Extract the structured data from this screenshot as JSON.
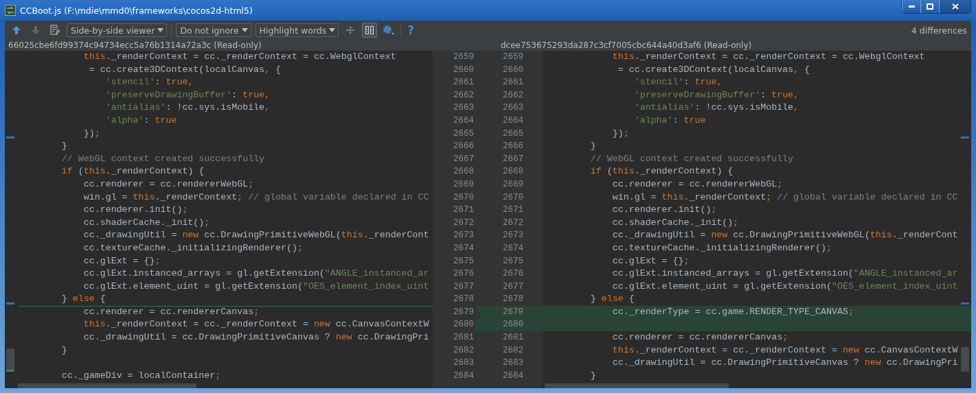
{
  "window": {
    "title": "CCBoot.js (F:\\mdie\\mmd0\\frameworks\\cocos2d-html5)"
  },
  "toolbar": {
    "buttons": [
      {
        "kind": "previous",
        "disabled": false
      },
      {
        "kind": "next",
        "disabled": true
      },
      {
        "kind": "edit",
        "disabled": false
      }
    ],
    "dropdowns": [
      "Side-by-side viewer",
      "Do not ignore",
      "Highlight words"
    ],
    "sync_scroll": {
      "selected": true
    },
    "help": "?",
    "status": "4 differences"
  },
  "panes": {
    "left": {
      "title": "66025cbe6fd99374c94734ecc5a76b1314a72a3c (Read-only)"
    },
    "right": {
      "title": "dcee753675293da287c3cf7005cbc644a40d3af6 (Read-only)"
    }
  },
  "rows": [
    {
      "left_number": "2659",
      "right_number": "2659",
      "inserted": false,
      "left": [
        {
          "kind": "keyword",
          "text": "            this"
        },
        {
          "kind": "plain",
          "text": "._renderContext = cc._renderContext = cc.WebglContext"
        }
      ],
      "right": [
        {
          "kind": "keyword",
          "text": "            this"
        },
        {
          "kind": "plain",
          "text": "._renderContext = cc._renderContext = cc.WebglContext"
        }
      ]
    },
    {
      "left_number": "2660",
      "right_number": "2660",
      "inserted": false,
      "left": [
        {
          "kind": "plain",
          "text": "             = cc.create3DContext(localCanvas"
        },
        {
          "kind": "keyword",
          "text": ","
        },
        {
          "kind": "plain",
          "text": " {"
        }
      ],
      "right": [
        {
          "kind": "plain",
          "text": "             = cc.create3DContext(localCanvas"
        },
        {
          "kind": "keyword",
          "text": ","
        },
        {
          "kind": "plain",
          "text": " {"
        }
      ]
    },
    {
      "left_number": "2661",
      "right_number": "2661",
      "inserted": false,
      "left": [
        {
          "kind": "string",
          "text": "                'stencil'"
        },
        {
          "kind": "plain",
          "text": ": "
        },
        {
          "kind": "keyword",
          "text": "true,"
        }
      ],
      "right": [
        {
          "kind": "string",
          "text": "                'stencil'"
        },
        {
          "kind": "plain",
          "text": ": "
        },
        {
          "kind": "keyword",
          "text": "true,"
        }
      ]
    },
    {
      "left_number": "2662",
      "right_number": "2662",
      "inserted": false,
      "left": [
        {
          "kind": "string",
          "text": "                'preserveDrawingBuffer'"
        },
        {
          "kind": "plain",
          "text": ": "
        },
        {
          "kind": "keyword",
          "text": "true,"
        }
      ],
      "right": [
        {
          "kind": "string",
          "text": "                'preserveDrawingBuffer'"
        },
        {
          "kind": "plain",
          "text": ": "
        },
        {
          "kind": "keyword",
          "text": "true,"
        }
      ]
    },
    {
      "left_number": "2663",
      "right_number": "2663",
      "inserted": false,
      "left": [
        {
          "kind": "string",
          "text": "                'antialias'"
        },
        {
          "kind": "plain",
          "text": ": !cc.sys.isMobile"
        },
        {
          "kind": "keyword",
          "text": ","
        }
      ],
      "right": [
        {
          "kind": "string",
          "text": "                'antialias'"
        },
        {
          "kind": "plain",
          "text": ": !cc.sys.isMobile"
        },
        {
          "kind": "keyword",
          "text": ","
        }
      ]
    },
    {
      "left_number": "2664",
      "right_number": "2664",
      "inserted": false,
      "left": [
        {
          "kind": "string",
          "text": "                'alpha'"
        },
        {
          "kind": "plain",
          "text": ": "
        },
        {
          "kind": "keyword",
          "text": "true"
        }
      ],
      "right": [
        {
          "kind": "string",
          "text": "                'alpha'"
        },
        {
          "kind": "plain",
          "text": ": "
        },
        {
          "kind": "keyword",
          "text": "true"
        }
      ]
    },
    {
      "left_number": "2665",
      "right_number": "2665",
      "inserted": false,
      "left": [
        {
          "kind": "plain",
          "text": "            })"
        },
        {
          "kind": "keyword",
          "text": ";"
        }
      ],
      "right": [
        {
          "kind": "plain",
          "text": "            })"
        },
        {
          "kind": "keyword",
          "text": ";"
        }
      ]
    },
    {
      "left_number": "2666",
      "right_number": "2666",
      "inserted": false,
      "left": [
        {
          "kind": "plain",
          "text": "        }"
        }
      ],
      "right": [
        {
          "kind": "plain",
          "text": "        }"
        }
      ]
    },
    {
      "left_number": "2667",
      "right_number": "2667",
      "inserted": false,
      "left": [
        {
          "kind": "comment",
          "text": "        // WebGL context created successfully"
        }
      ],
      "right": [
        {
          "kind": "comment",
          "text": "        // WebGL context created successfully"
        }
      ]
    },
    {
      "left_number": "2668",
      "right_number": "2668",
      "inserted": false,
      "left": [
        {
          "kind": "keyword",
          "text": "        if"
        },
        {
          "kind": "plain",
          "text": " ("
        },
        {
          "kind": "keyword",
          "text": "this"
        },
        {
          "kind": "plain",
          "text": "._renderContext) {"
        }
      ],
      "right": [
        {
          "kind": "keyword",
          "text": "        if"
        },
        {
          "kind": "plain",
          "text": " ("
        },
        {
          "kind": "keyword",
          "text": "this"
        },
        {
          "kind": "plain",
          "text": "._renderContext) {"
        }
      ]
    },
    {
      "left_number": "2669",
      "right_number": "2669",
      "inserted": false,
      "left": [
        {
          "kind": "plain",
          "text": "            cc.renderer = cc.rendererWebGL"
        },
        {
          "kind": "keyword",
          "text": ";"
        }
      ],
      "right": [
        {
          "kind": "plain",
          "text": "            cc.renderer = cc.rendererWebGL"
        },
        {
          "kind": "keyword",
          "text": ";"
        }
      ]
    },
    {
      "left_number": "2670",
      "right_number": "2670",
      "inserted": false,
      "left": [
        {
          "kind": "plain",
          "text": "            win.gl = "
        },
        {
          "kind": "keyword",
          "text": "this"
        },
        {
          "kind": "plain",
          "text": "._renderContext"
        },
        {
          "kind": "keyword",
          "text": ";"
        },
        {
          "kind": "comment",
          "text": " // global variable declared in CC"
        }
      ],
      "right": [
        {
          "kind": "plain",
          "text": "            win.gl = "
        },
        {
          "kind": "keyword",
          "text": "this"
        },
        {
          "kind": "plain",
          "text": "._renderContext"
        },
        {
          "kind": "keyword",
          "text": ";"
        },
        {
          "kind": "comment",
          "text": " // global variable declared in CC"
        }
      ]
    },
    {
      "left_number": "2671",
      "right_number": "2671",
      "inserted": false,
      "left": [
        {
          "kind": "plain",
          "text": "            cc.renderer.init()"
        },
        {
          "kind": "keyword",
          "text": ";"
        }
      ],
      "right": [
        {
          "kind": "plain",
          "text": "            cc.renderer.init()"
        },
        {
          "kind": "keyword",
          "text": ";"
        }
      ]
    },
    {
      "left_number": "2672",
      "right_number": "2672",
      "inserted": false,
      "left": [
        {
          "kind": "plain",
          "text": "            cc.shaderCache._init()"
        },
        {
          "kind": "keyword",
          "text": ";"
        }
      ],
      "right": [
        {
          "kind": "plain",
          "text": "            cc.shaderCache._init()"
        },
        {
          "kind": "keyword",
          "text": ";"
        }
      ]
    },
    {
      "left_number": "2673",
      "right_number": "2673",
      "inserted": false,
      "left": [
        {
          "kind": "plain",
          "text": "            cc._drawingUtil = "
        },
        {
          "kind": "keyword",
          "text": "new"
        },
        {
          "kind": "plain",
          "text": " cc.DrawingPrimitiveWebGL("
        },
        {
          "kind": "keyword",
          "text": "this"
        },
        {
          "kind": "plain",
          "text": "._renderCont"
        }
      ],
      "right": [
        {
          "kind": "plain",
          "text": "            cc._drawingUtil = "
        },
        {
          "kind": "keyword",
          "text": "new"
        },
        {
          "kind": "plain",
          "text": " cc.DrawingPrimitiveWebGL("
        },
        {
          "kind": "keyword",
          "text": "this"
        },
        {
          "kind": "plain",
          "text": "._renderCont"
        }
      ]
    },
    {
      "left_number": "2674",
      "right_number": "2674",
      "inserted": false,
      "left": [
        {
          "kind": "plain",
          "text": "            cc.textureCache._initializingRenderer()"
        },
        {
          "kind": "keyword",
          "text": ";"
        }
      ],
      "right": [
        {
          "kind": "plain",
          "text": "            cc.textureCache._initializingRenderer()"
        },
        {
          "kind": "keyword",
          "text": ";"
        }
      ]
    },
    {
      "left_number": "2675",
      "right_number": "2675",
      "inserted": false,
      "left": [
        {
          "kind": "plain",
          "text": "            cc.glExt = {}"
        },
        {
          "kind": "keyword",
          "text": ";"
        }
      ],
      "right": [
        {
          "kind": "plain",
          "text": "            cc.glExt = {}"
        },
        {
          "kind": "keyword",
          "text": ";"
        }
      ]
    },
    {
      "left_number": "2676",
      "right_number": "2676",
      "inserted": false,
      "left": [
        {
          "kind": "plain",
          "text": "            cc.glExt.instanced_arrays = gl.getExtension("
        },
        {
          "kind": "string",
          "text": "\"ANGLE_instanced_ar"
        }
      ],
      "right": [
        {
          "kind": "plain",
          "text": "            cc.glExt.instanced_arrays = gl.getExtension("
        },
        {
          "kind": "string",
          "text": "\"ANGLE_instanced_ar"
        }
      ]
    },
    {
      "left_number": "2677",
      "right_number": "2677",
      "inserted": false,
      "left": [
        {
          "kind": "plain",
          "text": "            cc.glExt.element_uint = gl.getExtension("
        },
        {
          "kind": "string",
          "text": "\"OES_element_index_uint"
        }
      ],
      "right": [
        {
          "kind": "plain",
          "text": "            cc.glExt.element_uint = gl.getExtension("
        },
        {
          "kind": "string",
          "text": "\"OES_element_index_uint"
        }
      ]
    },
    {
      "left_number": "2678",
      "right_number": "2678",
      "inserted": false,
      "left": [
        {
          "kind": "plain",
          "text": "        } "
        },
        {
          "kind": "keyword",
          "text": "else"
        },
        {
          "kind": "plain",
          "text": " {"
        }
      ],
      "right": [
        {
          "kind": "plain",
          "text": "        } "
        },
        {
          "kind": "keyword",
          "text": "else"
        },
        {
          "kind": "plain",
          "text": " {"
        }
      ]
    },
    {
      "left_number": "2679",
      "right_number": "2679",
      "inserted": true,
      "left": [
        {
          "kind": "plain",
          "text": "            cc.renderer = cc.rendererCanvas"
        },
        {
          "kind": "keyword",
          "text": ";"
        }
      ],
      "right": [
        {
          "kind": "plain",
          "text": "            cc._renderType = cc.game.RENDER_TYPE_CANVAS"
        },
        {
          "kind": "keyword",
          "text": ";"
        }
      ]
    },
    {
      "left_number": "2680",
      "right_number": "2680",
      "inserted": true,
      "left": [
        {
          "kind": "keyword",
          "text": "            this"
        },
        {
          "kind": "plain",
          "text": "._renderContext = cc._renderContext = "
        },
        {
          "kind": "keyword",
          "text": "new"
        },
        {
          "kind": "plain",
          "text": " cc.CanvasContextW"
        }
      ],
      "right": []
    },
    {
      "left_number": "2681",
      "right_number": "2681",
      "inserted": false,
      "left": [
        {
          "kind": "plain",
          "text": "            cc._drawingUtil = cc.DrawingPrimitiveCanvas ? "
        },
        {
          "kind": "keyword",
          "text": "new"
        },
        {
          "kind": "plain",
          "text": " cc.DrawingPri"
        }
      ],
      "right": [
        {
          "kind": "plain",
          "text": "            cc.renderer = cc.rendererCanvas"
        },
        {
          "kind": "keyword",
          "text": ";"
        }
      ]
    },
    {
      "left_number": "2682",
      "right_number": "2682",
      "inserted": false,
      "left": [
        {
          "kind": "plain",
          "text": "        }"
        }
      ],
      "right": [
        {
          "kind": "keyword",
          "text": "            this"
        },
        {
          "kind": "plain",
          "text": "._renderContext = cc._renderContext = "
        },
        {
          "kind": "keyword",
          "text": "new"
        },
        {
          "kind": "plain",
          "text": " cc.CanvasContextW"
        }
      ]
    },
    {
      "left_number": "2683",
      "right_number": "2683",
      "inserted": false,
      "left": [],
      "right": [
        {
          "kind": "plain",
          "text": "            cc._drawingUtil = cc.DrawingPrimitiveCanvas ? "
        },
        {
          "kind": "keyword",
          "text": "new"
        },
        {
          "kind": "plain",
          "text": " cc.DrawingPri"
        }
      ]
    },
    {
      "left_number": "2684",
      "right_number": "2684",
      "inserted": false,
      "left": [
        {
          "kind": "plain",
          "text": "        cc._gameDiv = localContainer"
        },
        {
          "kind": "keyword",
          "text": ";"
        }
      ],
      "right": [
        {
          "kind": "plain",
          "text": "        }"
        }
      ]
    }
  ]
}
